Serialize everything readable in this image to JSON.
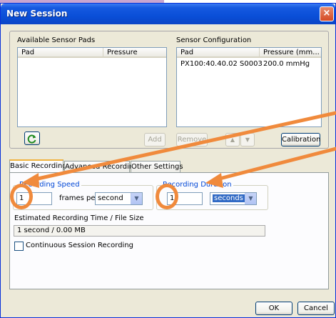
{
  "window": {
    "title": "New Session",
    "close_label": "×"
  },
  "available": {
    "label": "Available Sensor Pads",
    "columns": [
      "Pad",
      "Pressure"
    ],
    "rows": []
  },
  "config": {
    "label": "Sensor Configuration",
    "columns": [
      "Pad",
      "Pressure (mm..."
    ],
    "rows": [
      {
        "pad": "PX100:40.40.02 S0003",
        "pressure": "200.0 mmHg"
      }
    ]
  },
  "buttons": {
    "add": "Add",
    "remove": "Remove",
    "calibration": "Calibration",
    "ok": "OK",
    "cancel": "Cancel",
    "refresh_icon": "refresh-icon"
  },
  "tabs": [
    "Basic Recording",
    "Advanced Recording",
    "Other Settings"
  ],
  "speed": {
    "title": "Recording Speed",
    "value": "1",
    "frames_per": "frames per",
    "unit": "second"
  },
  "duration": {
    "title": "Recording Duration",
    "value": "1",
    "unit": "seconds"
  },
  "estimate": {
    "label": "Estimated Recording Time / File Size",
    "value": "1 second / 0.00 MB"
  },
  "continuous": {
    "label": "Continuous Session Recording",
    "checked": false
  },
  "colors": {
    "accent": "#0a4fd8",
    "annotation": "#f08a3c",
    "group_title": "#0046d5"
  }
}
